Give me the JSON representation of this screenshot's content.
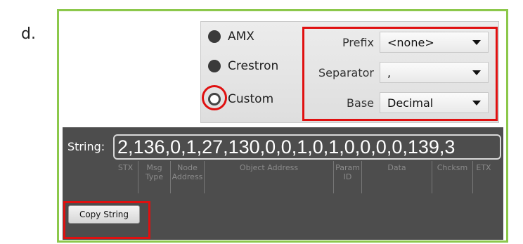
{
  "step_label": "d.",
  "radio": {
    "amx": "AMX",
    "crestron": "Crestron",
    "custom": "Custom"
  },
  "fields": {
    "prefix_label": "Prefix",
    "prefix_value": "<none>",
    "separator_label": "Separator",
    "separator_value": ",",
    "base_label": "Base",
    "base_value": "Decimal"
  },
  "string": {
    "label": "String:",
    "value": "2,136,0,1,27,130,0,0,1,0,1,0,0,0,0,139,3",
    "columns": [
      "STX",
      "Msg Type",
      "Node Address",
      "Object Address",
      "Param ID",
      "Data",
      "Chcksm",
      "ETX"
    ]
  },
  "copy_button": "Copy String",
  "colors": {
    "frame": "#8cc84b",
    "highlight": "#e01010",
    "panel": "#4d4d4d"
  }
}
